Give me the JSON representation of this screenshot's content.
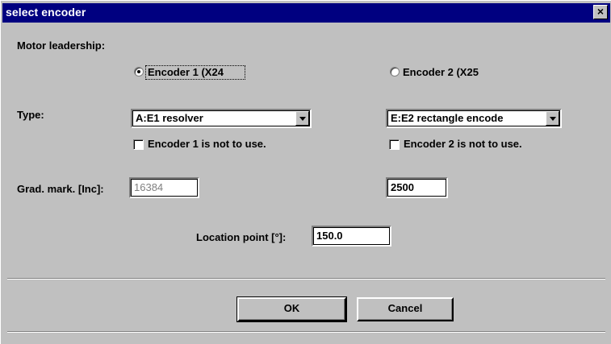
{
  "window": {
    "title": "select encoder",
    "close_glyph": "×"
  },
  "motor_leadership": {
    "label": "Motor leadership:"
  },
  "encoder1": {
    "radio_label": "Encoder 1 (X24",
    "type_value": "A:E1 resolver",
    "not_used_label": "Encoder 1 is not to use.",
    "grad_mark": "16384"
  },
  "encoder2": {
    "radio_label": "Encoder 2 (X25",
    "type_value": "E:E2 rectangle encode",
    "not_used_label": "Encoder 2 is not to use.",
    "grad_mark": "2500"
  },
  "type_label": "Type:",
  "grad_mark_label": "Grad. mark. [Inc]:",
  "location_point": {
    "label": "Location point [°]:",
    "value": "150.0"
  },
  "buttons": {
    "ok": "OK",
    "cancel": "Cancel"
  },
  "state": {
    "selected_encoder": 1,
    "encoder1_not_used": false,
    "encoder2_not_used": false
  }
}
